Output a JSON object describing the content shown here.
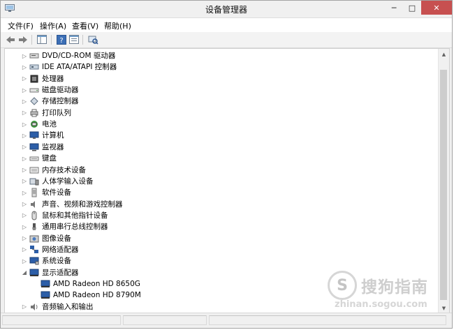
{
  "window": {
    "title": "设备管理器",
    "controls": {
      "minimize": "─",
      "maximize": "□",
      "close": "✕"
    }
  },
  "menu": [
    {
      "label": "文件(F)"
    },
    {
      "label": "操作(A)"
    },
    {
      "label": "查看(V)"
    },
    {
      "label": "帮助(H)"
    }
  ],
  "toolbar": {
    "icons": [
      "back-arrow-icon",
      "forward-arrow-icon",
      "show-hide-tree-icon",
      "help-icon",
      "properties-icon",
      "scan-hardware-icon"
    ]
  },
  "tree": {
    "items": [
      {
        "label": "DVD/CD-ROM 驱动器",
        "icon": "dvd-drive-icon",
        "state": "collapsed"
      },
      {
        "label": "IDE ATA/ATAPI 控制器",
        "icon": "ide-controller-icon",
        "state": "collapsed"
      },
      {
        "label": "处理器",
        "icon": "processor-icon",
        "state": "collapsed"
      },
      {
        "label": "磁盘驱动器",
        "icon": "disk-drive-icon",
        "state": "collapsed"
      },
      {
        "label": "存储控制器",
        "icon": "storage-controller-icon",
        "state": "collapsed"
      },
      {
        "label": "打印队列",
        "icon": "printer-icon",
        "state": "collapsed"
      },
      {
        "label": "电池",
        "icon": "battery-icon",
        "state": "collapsed"
      },
      {
        "label": "计算机",
        "icon": "computer-icon",
        "state": "collapsed"
      },
      {
        "label": "监视器",
        "icon": "monitor-icon",
        "state": "collapsed"
      },
      {
        "label": "键盘",
        "icon": "keyboard-icon",
        "state": "collapsed"
      },
      {
        "label": "内存技术设备",
        "icon": "memory-device-icon",
        "state": "collapsed"
      },
      {
        "label": "人体学输入设备",
        "icon": "hid-icon",
        "state": "collapsed"
      },
      {
        "label": "软件设备",
        "icon": "software-device-icon",
        "state": "collapsed"
      },
      {
        "label": "声音、视频和游戏控制器",
        "icon": "speaker-icon",
        "state": "collapsed"
      },
      {
        "label": "鼠标和其他指针设备",
        "icon": "mouse-icon",
        "state": "collapsed"
      },
      {
        "label": "通用串行总线控制器",
        "icon": "usb-icon",
        "state": "collapsed"
      },
      {
        "label": "图像设备",
        "icon": "imaging-device-icon",
        "state": "collapsed"
      },
      {
        "label": "网络适配器",
        "icon": "network-adapter-icon",
        "state": "collapsed"
      },
      {
        "label": "系统设备",
        "icon": "system-device-icon",
        "state": "collapsed"
      },
      {
        "label": "显示适配器",
        "icon": "display-adapter-icon",
        "state": "expanded",
        "children": [
          {
            "label": "AMD Radeon HD 8650G",
            "icon": "display-adapter-icon"
          },
          {
            "label": "AMD Radeon HD 8790M",
            "icon": "display-adapter-icon"
          }
        ]
      },
      {
        "label": "音频输入和输出",
        "icon": "audio-io-icon",
        "state": "collapsed"
      }
    ]
  },
  "watermark": {
    "logo_glyph": "S",
    "title": "搜狗指南",
    "url": "zhinan.sogou.com"
  }
}
